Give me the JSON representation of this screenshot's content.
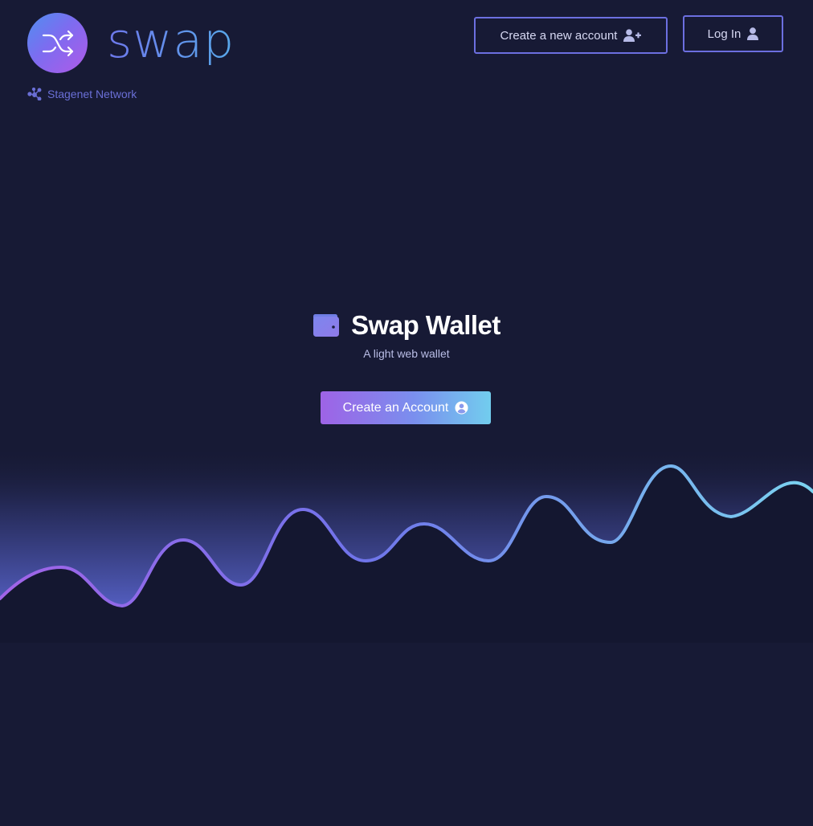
{
  "header": {
    "brand_name": "swap",
    "network_label": "Stagenet Network",
    "create_account_label": "Create a new account",
    "login_label": "Log In"
  },
  "hero": {
    "title": "Swap Wallet",
    "subtitle": "A light web wallet",
    "cta_label": "Create an Account"
  },
  "icons": {
    "logo": "shuffle-icon",
    "network": "network-nodes-icon",
    "create_account": "user-plus-icon",
    "login": "user-icon",
    "title": "wallet-icon",
    "cta": "user-circle-icon"
  },
  "colors": {
    "background": "#171a35",
    "accent": "#6c6fe0",
    "gradient_start": "#9e63e6",
    "gradient_end": "#72cdee",
    "network_text": "#6a6fd6"
  }
}
